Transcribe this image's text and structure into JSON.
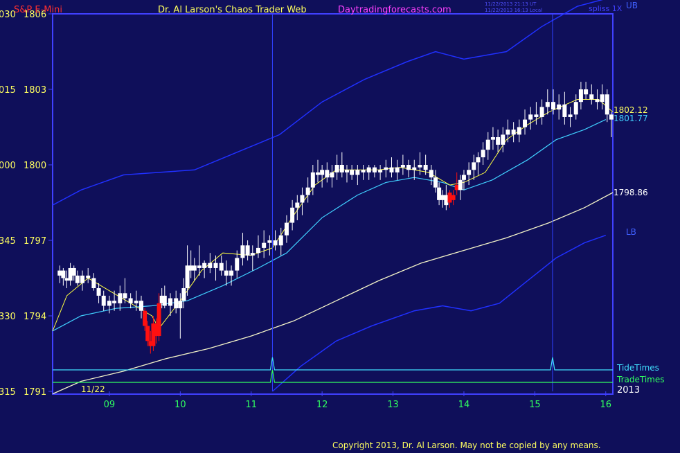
{
  "header": {
    "symbol": "S&P E-Mini",
    "author": "Dr. Al Larson's Chaos Trader Web",
    "site": "Daytradingforecasts.com",
    "stamp_utc": "11/22/2013 21:13 UT",
    "stamp_local": "11/22/2013 16:13 Local",
    "stamp_right": "spliss 1X"
  },
  "footer": {
    "copyright": "Copyright 2013, Dr. Al Larson. May not be copied by any means."
  },
  "chart_data": {
    "type": "candlestick",
    "x_tick_labels": [
      "09",
      "10",
      "11",
      "12",
      "13",
      "14",
      "15",
      "16"
    ],
    "x_ticks": [
      9,
      10,
      11,
      12,
      13,
      14,
      15,
      16
    ],
    "xlim": [
      8.2,
      16.1
    ],
    "ylim": [
      1791,
      1806
    ],
    "y_tick_labels": [
      "1806",
      "1803",
      "1800",
      "1797",
      "1794",
      "1791"
    ],
    "y_ticks": [
      1806,
      1803,
      1800,
      1797,
      1794,
      1791
    ],
    "left_tick_labels": [
      "030",
      "015",
      "000",
      "345",
      "330",
      "315"
    ],
    "date_label": "11/22",
    "year_label": "2013",
    "price_labels": {
      "ema_fast": "1802.12",
      "ema_mid": "1801.77",
      "ema_slow": "1798.86",
      "ub": "UB",
      "lb": "LB"
    },
    "time_lines": {
      "tide": {
        "name": "TideTimes",
        "spikes": [
          11.3,
          15.25
        ]
      },
      "trade": {
        "name": "TradeTimes",
        "spikes": [
          11.3
        ]
      }
    },
    "vertical_markers": [
      11.3,
      15.25
    ],
    "bands": {
      "ub": [
        [
          8.2,
          1798.4
        ],
        [
          8.6,
          1799.0
        ],
        [
          9.2,
          1799.6
        ],
        [
          9.7,
          1799.7
        ],
        [
          10.2,
          1799.8
        ],
        [
          10.8,
          1800.5
        ],
        [
          11.4,
          1801.2
        ],
        [
          12.0,
          1802.5
        ],
        [
          12.6,
          1803.4
        ],
        [
          13.2,
          1804.1
        ],
        [
          13.6,
          1804.5
        ],
        [
          14.0,
          1804.2
        ],
        [
          14.6,
          1804.5
        ],
        [
          15.1,
          1805.5
        ],
        [
          15.6,
          1806.3
        ],
        [
          16.0,
          1806.6
        ]
      ],
      "lb": [
        [
          11.3,
          1791.0
        ],
        [
          11.7,
          1792.0
        ],
        [
          12.2,
          1793.0
        ],
        [
          12.7,
          1793.6
        ],
        [
          13.3,
          1794.2
        ],
        [
          13.7,
          1794.4
        ],
        [
          14.1,
          1794.2
        ],
        [
          14.5,
          1794.5
        ],
        [
          14.9,
          1795.4
        ],
        [
          15.3,
          1796.3
        ],
        [
          15.7,
          1796.9
        ],
        [
          16.0,
          1797.2
        ]
      ],
      "ema_slow": [
        [
          8.2,
          1790.9
        ],
        [
          8.6,
          1791.4
        ],
        [
          9.2,
          1791.8
        ],
        [
          9.8,
          1792.3
        ],
        [
          10.4,
          1792.7
        ],
        [
          11.0,
          1793.2
        ],
        [
          11.6,
          1793.8
        ],
        [
          12.2,
          1794.6
        ],
        [
          12.8,
          1795.4
        ],
        [
          13.4,
          1796.1
        ],
        [
          14.0,
          1796.6
        ],
        [
          14.6,
          1797.1
        ],
        [
          15.2,
          1797.7
        ],
        [
          15.7,
          1798.3
        ],
        [
          16.1,
          1798.9
        ]
      ],
      "ema_mid": [
        [
          8.2,
          1793.4
        ],
        [
          8.6,
          1794.0
        ],
        [
          9.1,
          1794.3
        ],
        [
          9.6,
          1794.4
        ],
        [
          10.1,
          1794.6
        ],
        [
          10.6,
          1795.2
        ],
        [
          11.1,
          1795.9
        ],
        [
          11.5,
          1796.5
        ],
        [
          12.0,
          1797.9
        ],
        [
          12.5,
          1798.8
        ],
        [
          12.9,
          1799.3
        ],
        [
          13.3,
          1799.5
        ],
        [
          13.7,
          1799.3
        ],
        [
          14.0,
          1799.0
        ],
        [
          14.4,
          1799.4
        ],
        [
          14.9,
          1800.2
        ],
        [
          15.3,
          1801.0
        ],
        [
          15.7,
          1801.4
        ],
        [
          16.0,
          1801.8
        ]
      ],
      "ema_fast": [
        [
          8.2,
          1793.4
        ],
        [
          8.4,
          1794.8
        ],
        [
          8.7,
          1795.5
        ],
        [
          9.0,
          1795.0
        ],
        [
          9.3,
          1794.5
        ],
        [
          9.6,
          1794.0
        ],
        [
          9.7,
          1793.5
        ],
        [
          10.0,
          1794.6
        ],
        [
          10.3,
          1795.8
        ],
        [
          10.6,
          1796.5
        ],
        [
          11.0,
          1796.4
        ],
        [
          11.3,
          1796.7
        ],
        [
          11.6,
          1798.0
        ],
        [
          11.9,
          1799.2
        ],
        [
          12.2,
          1799.8
        ],
        [
          12.5,
          1799.8
        ],
        [
          12.8,
          1799.8
        ],
        [
          13.1,
          1799.9
        ],
        [
          13.5,
          1799.7
        ],
        [
          13.8,
          1799.2
        ],
        [
          14.0,
          1799.3
        ],
        [
          14.3,
          1799.7
        ],
        [
          14.6,
          1801.0
        ],
        [
          14.9,
          1801.6
        ],
        [
          15.2,
          1802.1
        ],
        [
          15.6,
          1802.6
        ],
        [
          15.9,
          1802.6
        ],
        [
          16.1,
          1802.1
        ]
      ]
    },
    "candles": [
      [
        8.3,
        1795.6,
        1796.0,
        1795.3,
        1795.8
      ],
      [
        8.35,
        1795.8,
        1795.9,
        1795.2,
        1795.5
      ],
      [
        8.4,
        1795.5,
        1795.8,
        1795.1,
        1795.4
      ],
      [
        8.45,
        1795.4,
        1796.1,
        1795.2,
        1795.9
      ],
      [
        8.5,
        1795.9,
        1796.0,
        1795.4,
        1795.6
      ],
      [
        8.55,
        1795.6,
        1795.8,
        1795.2,
        1795.3
      ],
      [
        8.62,
        1795.3,
        1795.8,
        1795.0,
        1795.6
      ],
      [
        8.7,
        1795.6,
        1795.9,
        1795.3,
        1795.5
      ],
      [
        8.78,
        1795.5,
        1795.7,
        1795.0,
        1795.1
      ],
      [
        8.85,
        1795.1,
        1795.3,
        1794.5,
        1794.8
      ],
      [
        8.92,
        1794.8,
        1795.0,
        1794.2,
        1794.4
      ],
      [
        9.0,
        1794.4,
        1794.8,
        1794.1,
        1794.6
      ],
      [
        9.07,
        1794.6,
        1795.0,
        1794.2,
        1794.5
      ],
      [
        9.15,
        1794.5,
        1795.2,
        1794.2,
        1794.9
      ],
      [
        9.22,
        1794.9,
        1795.5,
        1794.5,
        1794.7
      ],
      [
        9.3,
        1794.7,
        1794.9,
        1794.3,
        1794.5
      ],
      [
        9.38,
        1794.5,
        1795.0,
        1794.2,
        1794.6
      ],
      [
        9.45,
        1794.6,
        1794.8,
        1793.9,
        1794.2
      ],
      [
        9.5,
        1794.2,
        1794.3,
        1793.4,
        1793.6
      ],
      [
        9.54,
        1793.6,
        1793.8,
        1792.8,
        1793.0
      ],
      [
        9.58,
        1793.0,
        1793.4,
        1792.5,
        1792.8
      ],
      [
        9.62,
        1792.8,
        1794.0,
        1792.6,
        1793.7
      ],
      [
        9.66,
        1793.7,
        1793.9,
        1792.9,
        1793.2
      ],
      [
        9.7,
        1793.2,
        1794.9,
        1793.0,
        1794.5
      ],
      [
        9.74,
        1794.5,
        1795.1,
        1794.3,
        1794.8
      ],
      [
        9.78,
        1794.8,
        1795.2,
        1794.3,
        1794.4
      ],
      [
        9.86,
        1794.4,
        1794.9,
        1794.0,
        1794.7
      ],
      [
        9.94,
        1794.7,
        1795.0,
        1794.1,
        1794.3
      ],
      [
        10.0,
        1794.3,
        1794.9,
        1793.1,
        1794.6
      ],
      [
        10.05,
        1794.6,
        1795.5,
        1794.3,
        1795.1
      ],
      [
        10.1,
        1795.1,
        1796.8,
        1794.8,
        1796.0
      ],
      [
        10.15,
        1796.0,
        1796.6,
        1795.5,
        1795.8
      ],
      [
        10.2,
        1795.8,
        1796.3,
        1795.4,
        1796.0
      ],
      [
        10.27,
        1796.0,
        1796.8,
        1795.6,
        1795.9
      ],
      [
        10.34,
        1795.9,
        1796.2,
        1795.5,
        1796.1
      ],
      [
        10.42,
        1796.1,
        1796.5,
        1795.7,
        1795.9
      ],
      [
        10.5,
        1795.9,
        1796.4,
        1795.4,
        1796.1
      ],
      [
        10.58,
        1796.1,
        1796.4,
        1795.6,
        1795.8
      ],
      [
        10.65,
        1795.8,
        1796.2,
        1795.2,
        1795.6
      ],
      [
        10.72,
        1795.6,
        1796.0,
        1795.2,
        1795.8
      ],
      [
        10.8,
        1795.8,
        1796.6,
        1795.5,
        1796.3
      ],
      [
        10.88,
        1796.3,
        1797.3,
        1796.0,
        1796.8
      ],
      [
        10.95,
        1796.8,
        1797.0,
        1796.2,
        1796.4
      ],
      [
        11.02,
        1796.4,
        1796.8,
        1795.8,
        1796.5
      ],
      [
        11.1,
        1796.5,
        1797.2,
        1796.3,
        1796.7
      ],
      [
        11.18,
        1796.7,
        1797.4,
        1796.3,
        1796.9
      ],
      [
        11.26,
        1796.9,
        1797.2,
        1796.4,
        1797.0
      ],
      [
        11.34,
        1797.0,
        1797.4,
        1796.6,
        1796.8
      ],
      [
        11.42,
        1796.8,
        1797.5,
        1796.4,
        1797.2
      ],
      [
        11.5,
        1797.2,
        1798.0,
        1796.9,
        1797.7
      ],
      [
        11.58,
        1797.7,
        1798.6,
        1797.4,
        1798.3
      ],
      [
        11.65,
        1798.3,
        1798.8,
        1797.8,
        1798.5
      ],
      [
        11.72,
        1798.5,
        1799.1,
        1798.0,
        1798.8
      ],
      [
        11.8,
        1798.8,
        1799.5,
        1798.5,
        1799.1
      ],
      [
        11.87,
        1799.1,
        1800.0,
        1798.8,
        1799.7
      ],
      [
        11.94,
        1799.7,
        1800.2,
        1799.3,
        1799.6
      ],
      [
        12.0,
        1799.6,
        1800.0,
        1799.1,
        1799.8
      ],
      [
        12.07,
        1799.8,
        1800.1,
        1799.3,
        1799.5
      ],
      [
        12.14,
        1799.5,
        1800.0,
        1799.1,
        1799.7
      ],
      [
        12.21,
        1799.7,
        1800.4,
        1799.4,
        1800.0
      ],
      [
        12.28,
        1800.0,
        1800.5,
        1799.5,
        1799.7
      ],
      [
        12.35,
        1799.7,
        1800.0,
        1799.3,
        1799.8
      ],
      [
        12.42,
        1799.8,
        1800.0,
        1799.4,
        1799.6
      ],
      [
        12.5,
        1799.6,
        1800.0,
        1799.2,
        1799.8
      ],
      [
        12.58,
        1799.8,
        1800.0,
        1799.4,
        1799.7
      ],
      [
        12.66,
        1799.7,
        1800.0,
        1799.4,
        1799.9
      ],
      [
        12.74,
        1799.9,
        1800.0,
        1799.5,
        1799.7
      ],
      [
        12.82,
        1799.7,
        1800.0,
        1799.4,
        1799.8
      ],
      [
        12.9,
        1799.8,
        1800.2,
        1799.5,
        1799.9
      ],
      [
        12.98,
        1799.9,
        1800.3,
        1799.5,
        1799.7
      ],
      [
        13.06,
        1799.7,
        1800.2,
        1799.4,
        1799.9
      ],
      [
        13.14,
        1799.9,
        1800.4,
        1799.6,
        1800.0
      ],
      [
        13.22,
        1800.0,
        1800.2,
        1799.5,
        1799.8
      ],
      [
        13.3,
        1799.8,
        1800.2,
        1799.4,
        1799.9
      ],
      [
        13.38,
        1799.9,
        1800.5,
        1799.6,
        1800.0
      ],
      [
        13.46,
        1800.0,
        1800.4,
        1799.6,
        1799.8
      ],
      [
        13.54,
        1799.8,
        1800.0,
        1799.2,
        1799.5
      ],
      [
        13.6,
        1799.5,
        1799.8,
        1798.9,
        1799.1
      ],
      [
        13.65,
        1799.1,
        1799.3,
        1798.4,
        1798.6
      ],
      [
        13.7,
        1798.6,
        1799.0,
        1798.3,
        1798.8
      ],
      [
        13.75,
        1798.8,
        1799.2,
        1798.2,
        1798.4
      ],
      [
        13.8,
        1798.9,
        1799.0,
        1798.3,
        1798.5
      ],
      [
        13.85,
        1798.8,
        1799.0,
        1798.4,
        1798.6
      ],
      [
        13.9,
        1799.2,
        1799.7,
        1798.8,
        1799.0
      ],
      [
        13.95,
        1799.0,
        1799.6,
        1798.6,
        1799.4
      ],
      [
        14.0,
        1799.4,
        1799.8,
        1799.0,
        1799.6
      ],
      [
        14.07,
        1799.6,
        1800.1,
        1799.2,
        1799.8
      ],
      [
        14.14,
        1799.8,
        1800.4,
        1799.4,
        1800.1
      ],
      [
        14.2,
        1800.1,
        1800.5,
        1799.6,
        1800.3
      ],
      [
        14.27,
        1800.3,
        1800.9,
        1800.0,
        1800.6
      ],
      [
        14.34,
        1800.6,
        1801.3,
        1800.2,
        1801.0
      ],
      [
        14.41,
        1801.0,
        1801.5,
        1800.6,
        1801.1
      ],
      [
        14.48,
        1801.1,
        1801.4,
        1800.5,
        1800.8
      ],
      [
        14.55,
        1800.8,
        1801.5,
        1800.5,
        1801.2
      ],
      [
        14.62,
        1801.2,
        1801.8,
        1800.9,
        1801.4
      ],
      [
        14.7,
        1801.4,
        1801.7,
        1800.9,
        1801.2
      ],
      [
        14.78,
        1801.2,
        1801.8,
        1800.9,
        1801.5
      ],
      [
        14.86,
        1801.5,
        1802.2,
        1801.2,
        1801.8
      ],
      [
        14.94,
        1801.8,
        1802.3,
        1801.4,
        1802.0
      ],
      [
        15.02,
        1802.0,
        1802.5,
        1801.6,
        1801.9
      ],
      [
        15.1,
        1801.9,
        1802.6,
        1801.6,
        1802.3
      ],
      [
        15.18,
        1802.3,
        1803.0,
        1802.0,
        1802.5
      ],
      [
        15.26,
        1802.5,
        1803.0,
        1802.0,
        1802.2
      ],
      [
        15.34,
        1802.2,
        1802.8,
        1801.8,
        1802.4
      ],
      [
        15.42,
        1802.4,
        1802.9,
        1801.6,
        1801.9
      ],
      [
        15.5,
        1801.9,
        1802.3,
        1801.5,
        1802.0
      ],
      [
        15.58,
        1802.0,
        1802.8,
        1801.8,
        1802.5
      ],
      [
        15.65,
        1802.5,
        1803.3,
        1802.2,
        1803.0
      ],
      [
        15.72,
        1803.0,
        1803.3,
        1802.6,
        1802.8
      ],
      [
        15.8,
        1802.8,
        1803.2,
        1802.4,
        1802.6
      ],
      [
        15.88,
        1802.6,
        1803.0,
        1802.2,
        1802.5
      ],
      [
        15.95,
        1802.5,
        1803.2,
        1802.2,
        1802.8
      ],
      [
        16.02,
        1802.8,
        1803.0,
        1801.7,
        1802.0
      ],
      [
        16.08,
        1802.0,
        1802.1,
        1801.1,
        1801.8
      ]
    ]
  }
}
